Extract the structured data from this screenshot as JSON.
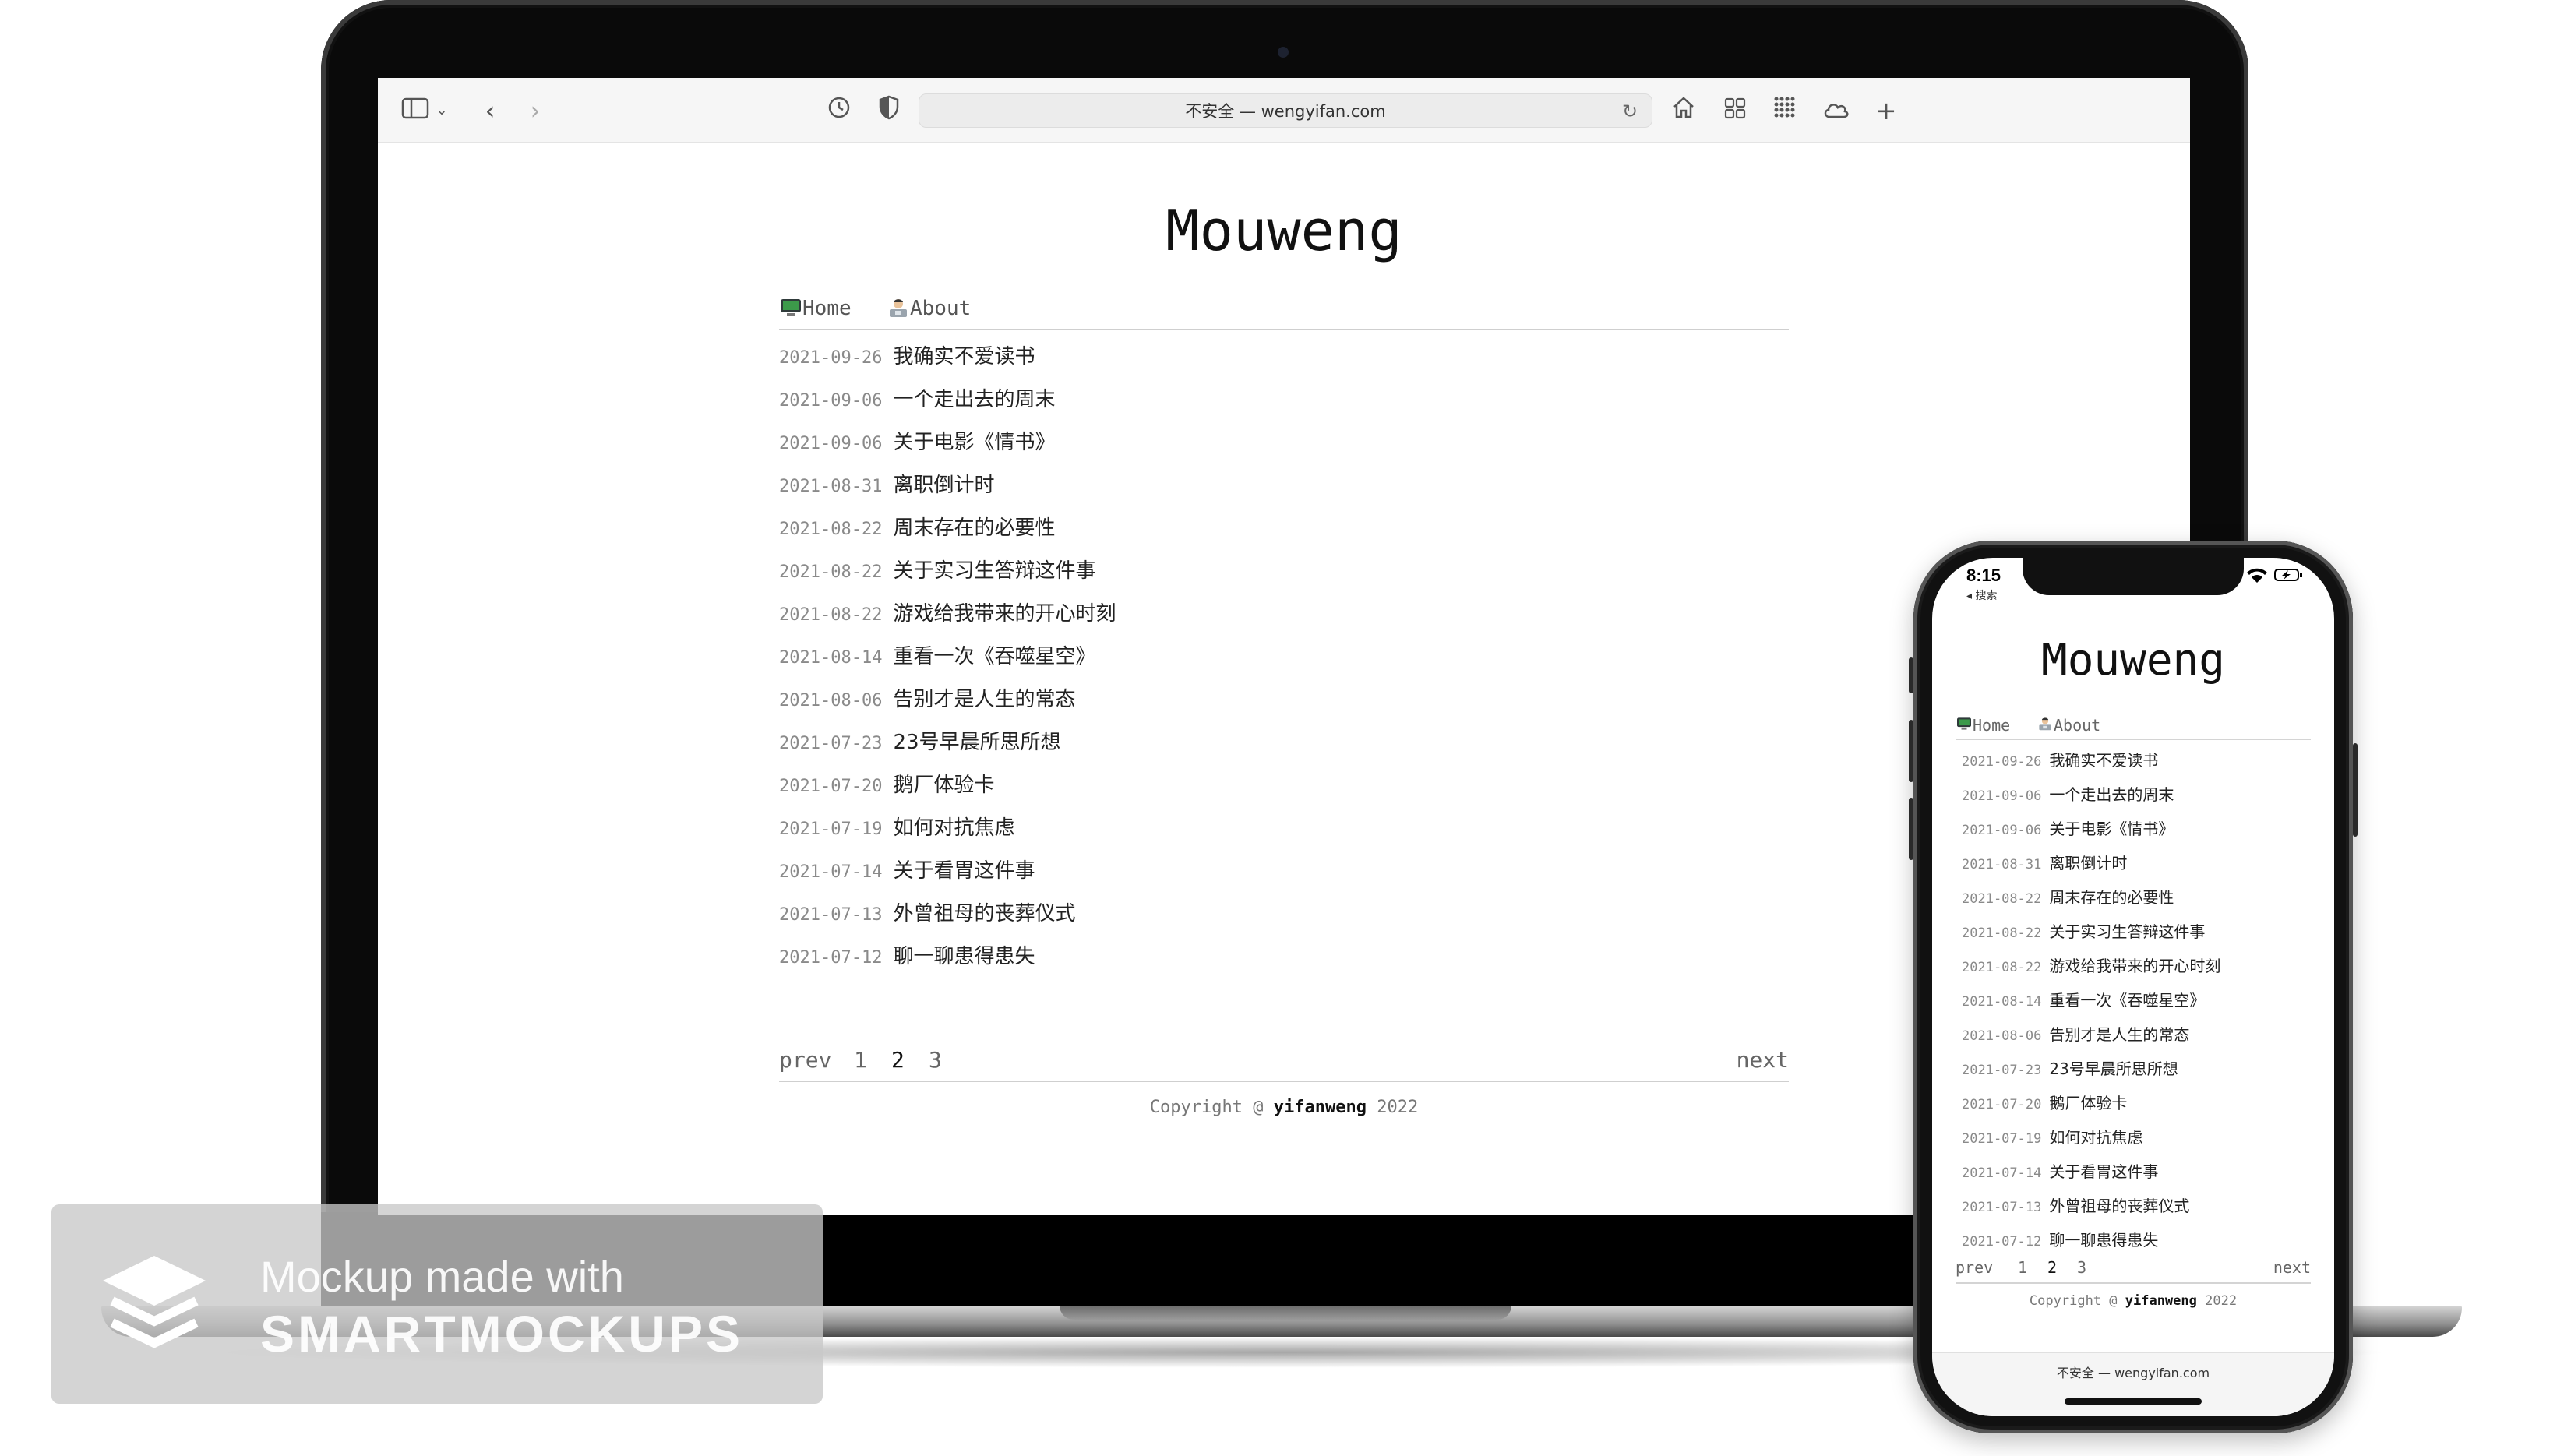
{
  "browser": {
    "address": "不安全 — wengyifan.com",
    "icons": [
      "sidebar-icon",
      "chevron-down-icon",
      "back-icon",
      "forward-icon",
      "history-icon",
      "shield-icon",
      "reload-icon",
      "home-icon",
      "tab-overview-icon",
      "grid-icon",
      "cloud-icon",
      "plus-icon"
    ]
  },
  "blog": {
    "title": "Mouweng",
    "nav": [
      {
        "label": "Home"
      },
      {
        "label": "About"
      }
    ],
    "posts": [
      {
        "date": "2021-09-26",
        "title": "我确实不爱读书"
      },
      {
        "date": "2021-09-06",
        "title": "一个走出去的周末"
      },
      {
        "date": "2021-09-06",
        "title": "关于电影《情书》"
      },
      {
        "date": "2021-08-31",
        "title": "离职倒计时"
      },
      {
        "date": "2021-08-22",
        "title": "周末存在的必要性"
      },
      {
        "date": "2021-08-22",
        "title": "关于实习生答辩这件事"
      },
      {
        "date": "2021-08-22",
        "title": "游戏给我带来的开心时刻"
      },
      {
        "date": "2021-08-14",
        "title": "重看一次《吞噬星空》"
      },
      {
        "date": "2021-08-06",
        "title": "告别才是人生的常态"
      },
      {
        "date": "2021-07-23",
        "title": "23号早晨所思所想"
      },
      {
        "date": "2021-07-20",
        "title": "鹅厂体验卡"
      },
      {
        "date": "2021-07-19",
        "title": "如何对抗焦虑"
      },
      {
        "date": "2021-07-14",
        "title": "关于看胃这件事"
      },
      {
        "date": "2021-07-13",
        "title": "外曾祖母的丧葬仪式"
      },
      {
        "date": "2021-07-12",
        "title": "聊一聊患得患失"
      }
    ],
    "pager": {
      "prev": "prev",
      "pages": [
        "1",
        "2",
        "3"
      ],
      "next": "next"
    },
    "footer": {
      "prefix": "Copyright @ ",
      "author": "yifanweng",
      "year": " 2022"
    }
  },
  "phone": {
    "time": "8:15",
    "back_label": "◂ 搜索",
    "url": "不安全 — wengyifan.com"
  },
  "watermark": {
    "line1": "Mockup made with",
    "line2": "SMARTMOCKUPS"
  }
}
